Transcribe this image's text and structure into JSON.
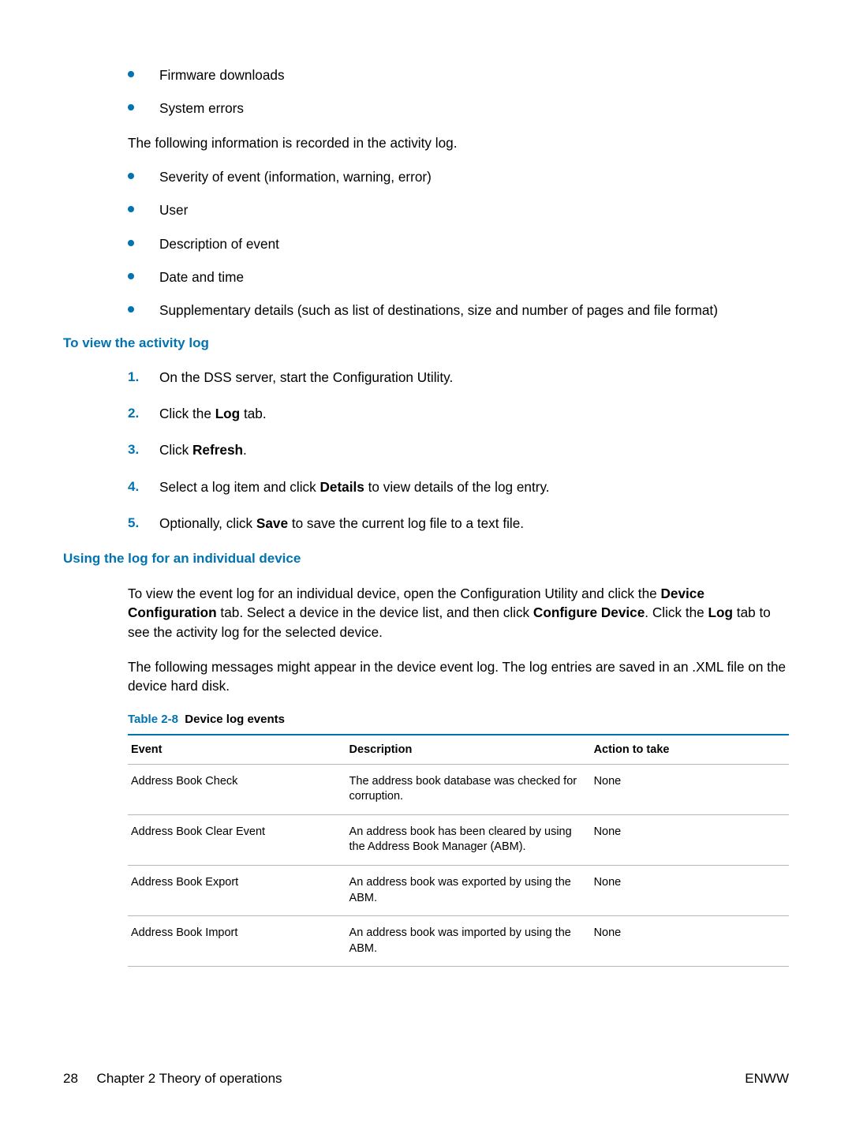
{
  "intro_bullets": [
    "Firmware downloads",
    "System errors"
  ],
  "intro_paragraph": "The following information is recorded in the activity log.",
  "info_bullets": [
    "Severity of event (information, warning, error)",
    "User",
    "Description of event",
    "Date and time",
    "Supplementary details (such as list of destinations, size and number of pages and file format)"
  ],
  "section1": {
    "heading": "To view the activity log",
    "steps": [
      {
        "num": "1.",
        "html": "On the DSS server, start the Configuration Utility."
      },
      {
        "num": "2.",
        "html": "Click the <b>Log</b> tab."
      },
      {
        "num": "3.",
        "html": "Click <b>Refresh</b>."
      },
      {
        "num": "4.",
        "html": "Select a log item and click <b>Details</b> to view details of the log entry."
      },
      {
        "num": "5.",
        "html": "Optionally, click <b>Save</b> to save the current log file to a text file."
      }
    ]
  },
  "section2": {
    "heading": "Using the log for an individual device",
    "p1_html": "To view the event log for an individual device, open the Configuration Utility and click the <b>Device Configuration</b> tab. Select a device in the device list, and then click <b>Configure Device</b>. Click the <b>Log</b> tab to see the activity log for the selected device.",
    "p2": "The following messages might appear in the device event log. The log entries are saved in an .XML file on the device hard disk."
  },
  "table": {
    "caption_label": "Table 2-8",
    "caption_title": "Device log events",
    "headers": {
      "event": "Event",
      "description": "Description",
      "action": "Action to take"
    },
    "rows": [
      {
        "event": "Address Book Check",
        "description": "The address book database was checked for corruption.",
        "action": "None"
      },
      {
        "event": "Address Book Clear Event",
        "description": "An address book has been cleared by using the Address Book Manager (ABM).",
        "action": "None"
      },
      {
        "event": "Address Book Export",
        "description": "An address book was exported by using the ABM.",
        "action": "None"
      },
      {
        "event": "Address Book Import",
        "description": "An address book was imported by using the ABM.",
        "action": "None"
      }
    ]
  },
  "footer": {
    "left_page": "28",
    "left_text": "Chapter 2   Theory of operations",
    "right": "ENWW"
  }
}
